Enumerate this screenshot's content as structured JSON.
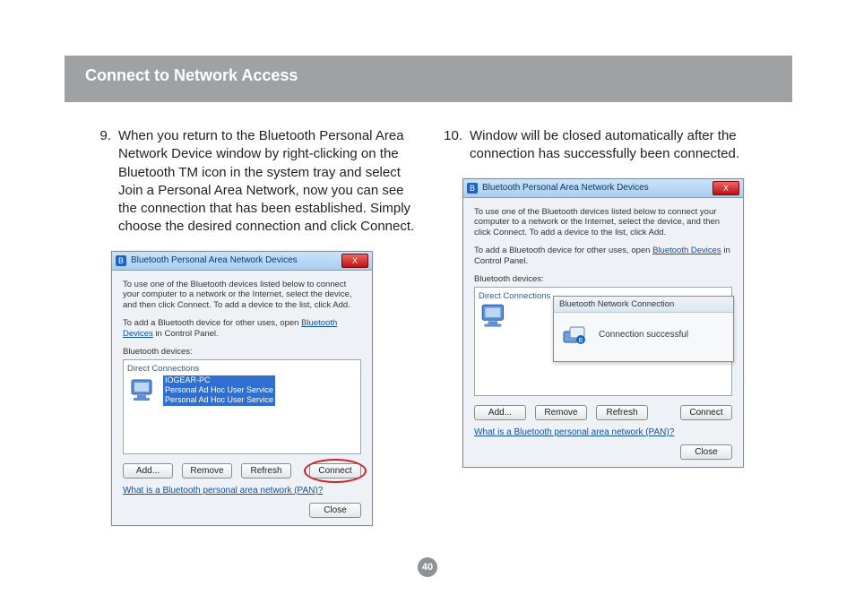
{
  "header": {
    "title": "Connect to Network Access"
  },
  "page_number": "40",
  "col_left": {
    "num": "9.",
    "text": "When you return to the Bluetooth Personal Area Network Device window by right-clicking on the Bluetooth TM icon in the system tray and select Join a Personal Area Network, now you can see the connection that has been established. Simply choose the desired connection and click Connect."
  },
  "col_right": {
    "num": "10.",
    "text": "Window will be closed automatically after the connection has successfully been connected."
  },
  "dialog": {
    "title": "Bluetooth Personal Area Network Devices",
    "intro": "To use one of the Bluetooth devices listed below to connect your computer to a network or the Internet, select the device, and then click Connect. To add a device to the list, click Add.",
    "add_other_pre": "To add a Bluetooth device for other uses, open ",
    "add_other_link": "Bluetooth Devices",
    "add_other_post": " in Control Panel.",
    "list_label": "Bluetooth devices:",
    "group_header": "Direct Connections",
    "device_name": "IOGEAR-PC",
    "device_line2": "Personal Ad Hoc User Service",
    "device_line3": "Personal Ad Hoc User Service",
    "buttons": {
      "add": "Add...",
      "remove": "Remove",
      "refresh": "Refresh",
      "connect": "Connect",
      "close": "Close"
    },
    "help_link": "What is a Bluetooth personal area network (PAN)?"
  },
  "popup": {
    "title": "Bluetooth Network Connection",
    "message": "Connection successful"
  },
  "icons": {
    "bluetooth_glyph": "B",
    "close_glyph": "X"
  }
}
